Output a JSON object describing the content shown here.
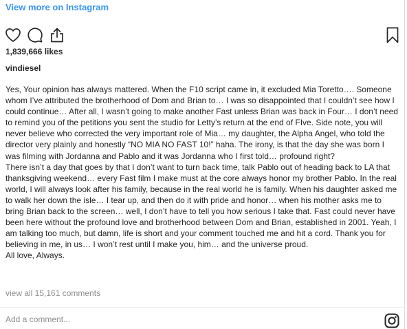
{
  "header": {
    "view_more_label": "View more on Instagram"
  },
  "actions": {
    "icons": [
      "heart-icon",
      "comment-icon",
      "share-icon",
      "bookmark-icon"
    ]
  },
  "post": {
    "likes": "1,839,666 likes",
    "author": "vindiesel",
    "caption_paragraphs": [
      "Yes, Your opinion has always mattered. When the F10 script came in, it excluded Mia Toretto…. Someone whom I’ve attributed the brotherhood of Dom and Brian to… I was so disappointed that I couldn’t see how I could continue… After all, I wasn’t going to make another Fast unless Brian was back in Four… I don’t need to remind you of the petitions you sent the studio for Letty’s return at the end of FIve. Side note, you will never believe who corrected the very important role of Mia… my daughter, the Alpha Angel, who told the director very plainly and honestly “NO MIA NO FAST 10!” haha. The irony, is that the day she was born I was filming with Jordanna and Pablo and it was Jordanna who I first told… profound right?",
      "There isn’t a day that goes by that I don’t want to turn back time, talk Pablo out of heading back to LA that thanksgiving weekend… every Fast film I make must at the core always honor my brother Pablo. In the real world, I will always look after his family, because in the real world he is family. When his daughter asked me to walk her down the isle… I tear up, and then do it with pride and honor… when his mother asks me to bring Brian back to the screen… well, I don’t have to tell you how serious I take that. Fast could never have been here without the profound love and brotherhood between Dom and Brian, established in 2001. Yeah, I am talking too much, but damn, life is short and your comment touched me and hit a cord. Thank you for believing in me, in us… I won’t rest until I make you, him… and the universe proud.",
      "All love, Always."
    ],
    "view_all_comments": "view all 15,161 comments"
  },
  "comment_box": {
    "placeholder": "Add a comment..."
  },
  "footer": {
    "logo_icon": "instagram-icon"
  },
  "colors": {
    "link": "#3897f0",
    "text": "#262626",
    "muted": "#8e8e8e",
    "divider": "#efefef"
  }
}
